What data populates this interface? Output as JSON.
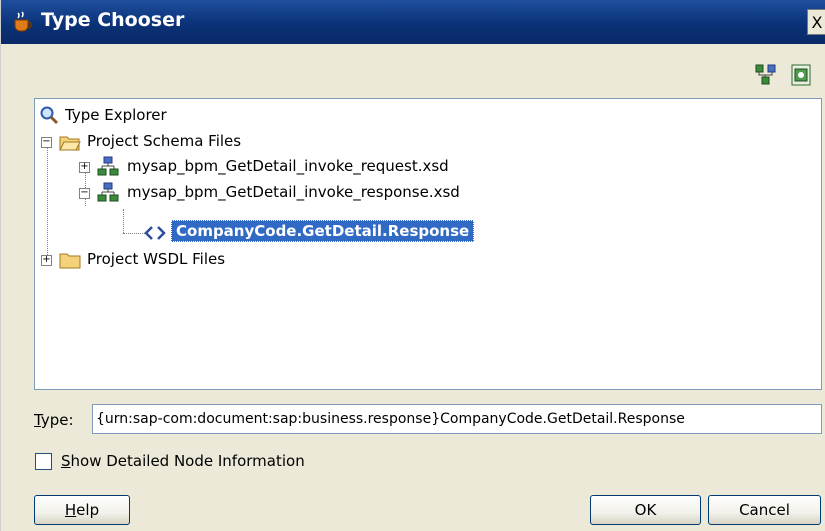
{
  "window": {
    "title": "Type Chooser",
    "close_glyph": "X"
  },
  "toolbar": {
    "icons": [
      "schema-structure-icon",
      "import-schema-icon"
    ]
  },
  "tree": {
    "root": "Type Explorer",
    "schema_folder": "Project Schema Files",
    "request_file": "mysap_bpm_GetDetail_invoke_request.xsd",
    "response_file": "mysap_bpm_GetDetail_invoke_response.xsd",
    "selected_element": "CompanyCode.GetDetail.Response",
    "wsdl_folder": "Project WSDL Files"
  },
  "type_field": {
    "label_mnemonic": "T",
    "label_rest": "ype:",
    "value": "{urn:sap-com:document:sap:business.response}CompanyCode.GetDetail.Response"
  },
  "show_detail": {
    "label_mnemonic": "S",
    "label_rest": "how Detailed Node Information",
    "checked": false
  },
  "buttons": {
    "help_mnemonic": "H",
    "help_rest": "elp",
    "ok": "OK",
    "cancel": "Cancel"
  },
  "colors": {
    "titlebar": "#0a3278",
    "selection": "#316ac5",
    "dialog_bg": "#ece9d8"
  }
}
